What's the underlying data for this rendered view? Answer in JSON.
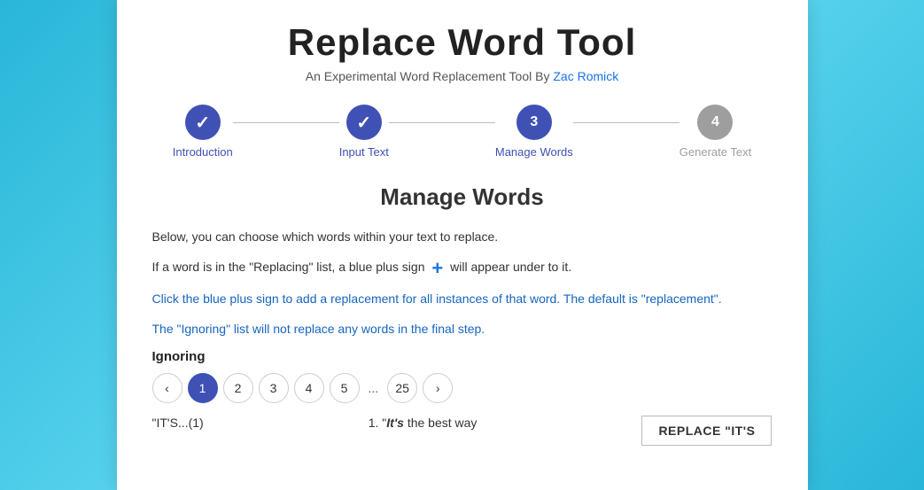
{
  "page": {
    "title": "Replace Word Tool",
    "subtitle": "An Experimental Word Replacement Tool By",
    "author_link_text": "Zac Romick",
    "author_link_url": "#"
  },
  "stepper": {
    "steps": [
      {
        "id": "introduction",
        "label": "Introduction",
        "state": "completed",
        "display": "✓"
      },
      {
        "id": "input-text",
        "label": "Input Text",
        "state": "completed",
        "display": "✓"
      },
      {
        "id": "manage-words",
        "label": "Manage Words",
        "state": "active",
        "display": "3"
      },
      {
        "id": "generate-text",
        "label": "Generate Text",
        "state": "inactive",
        "display": "4"
      }
    ]
  },
  "section": {
    "title": "Manage Words",
    "desc1": "Below, you can choose which words within your text to replace.",
    "desc2_before": "If a word is in the \"Replacing\" list, a blue plus sign",
    "desc2_after": "will appear under to it.",
    "desc3": "Click the blue plus sign to add a replacement for all instances of that word. The default is \"replacement\".",
    "desc4": "The \"Ignoring\" list will not replace any words in the final step."
  },
  "ignoring": {
    "label": "Ignoring"
  },
  "pagination": {
    "pages": [
      "1",
      "2",
      "3",
      "4",
      "5",
      "...",
      "25"
    ],
    "active_page": "1",
    "prev_label": "‹",
    "next_label": "›"
  },
  "word_list": {
    "tag": "\"IT'S...(1)",
    "preview_number": "1.",
    "preview_text_before": "\"",
    "preview_bold_italic": "It's",
    "preview_text_after": " the best way"
  },
  "replace_button": {
    "label": "REPLACE \"IT'S"
  }
}
